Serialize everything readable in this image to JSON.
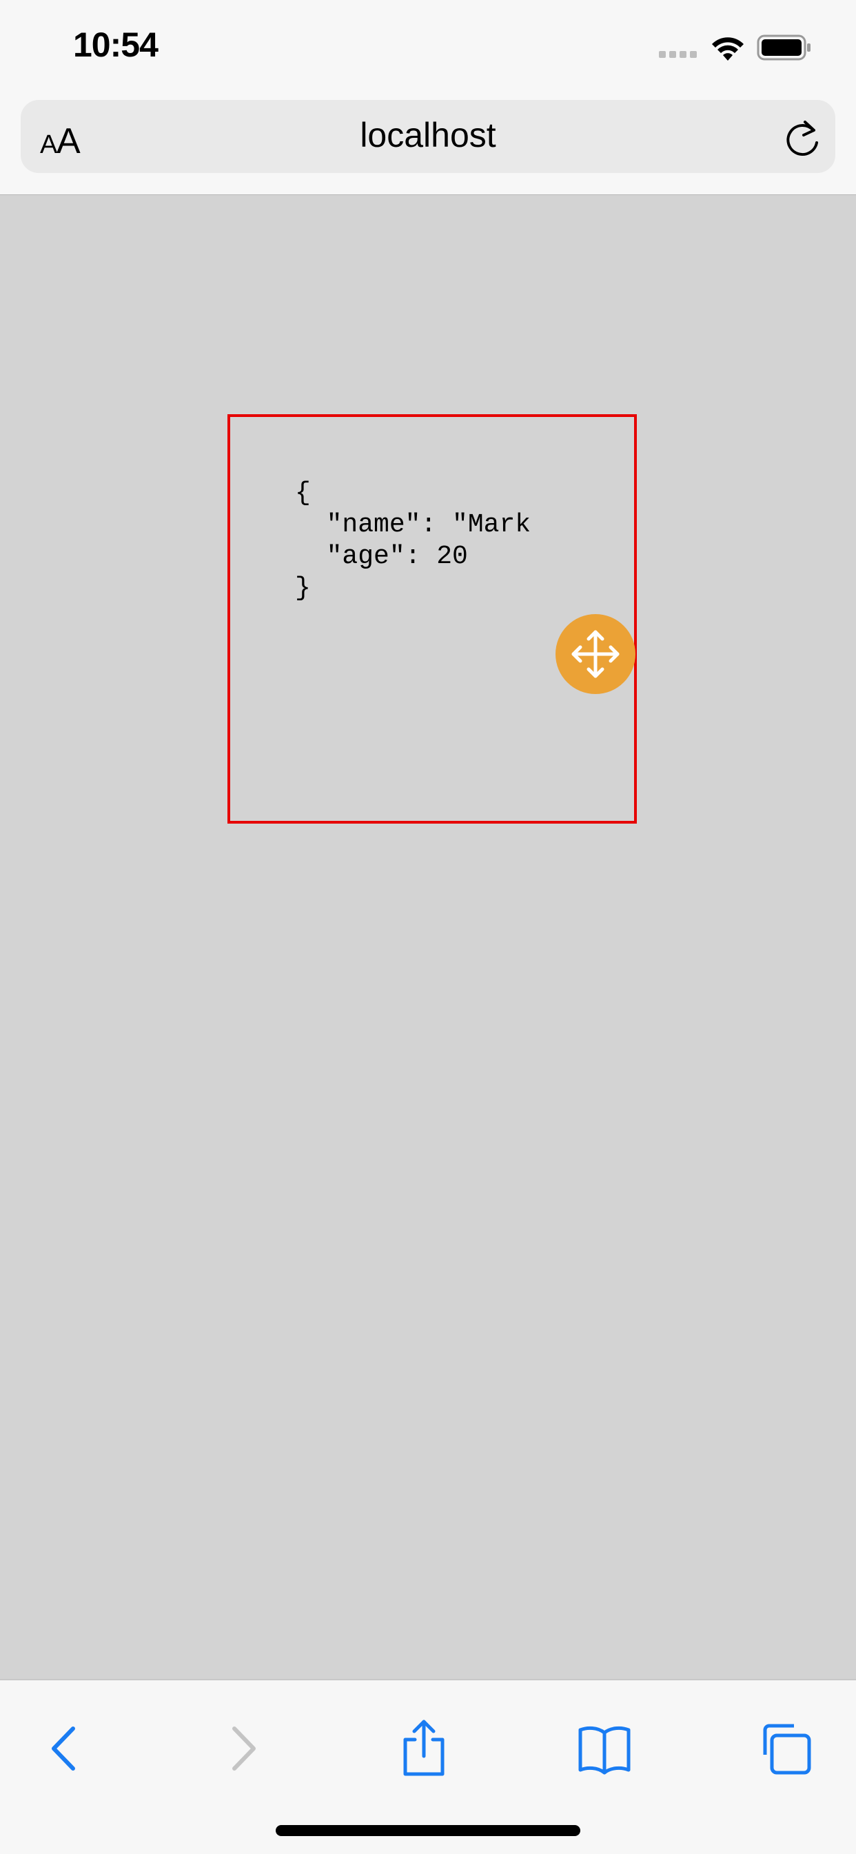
{
  "status_bar": {
    "time": "10:54"
  },
  "browser": {
    "text_size_small": "A",
    "text_size_large": "A",
    "url": "localhost"
  },
  "content": {
    "json_lines": "{\n  \"name\": \"Mark\n  \"age\": 20\n}"
  },
  "icons": {
    "signal": "cellular-signal-icon",
    "wifi": "wifi-icon",
    "battery": "battery-icon",
    "reload": "reload-icon",
    "move": "move-arrows-icon",
    "back": "chevron-left-icon",
    "forward": "chevron-right-icon",
    "share": "share-icon",
    "bookmarks": "book-icon",
    "tabs": "tabs-icon"
  },
  "colors": {
    "accent": "#1a7cf2",
    "disabled": "#c4c4c4",
    "box_border": "#e60000",
    "move_handle": "#eba236",
    "page_background": "#d3d3d3"
  }
}
